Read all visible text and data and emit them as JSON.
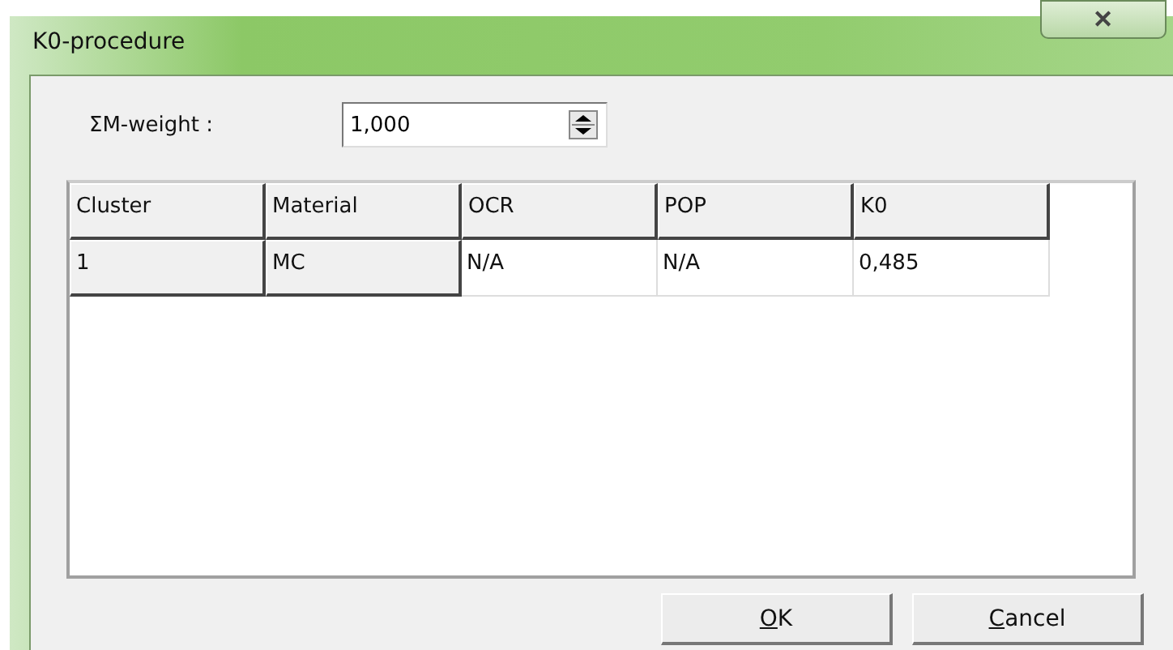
{
  "window": {
    "title": "K0-procedure",
    "close": "✕"
  },
  "weight": {
    "label": "ΣM-weight :",
    "value": "1,000"
  },
  "table": {
    "columns": [
      "Cluster",
      "Material",
      "OCR",
      "POP",
      "K0"
    ],
    "rows": [
      {
        "cells": [
          "1",
          "MC",
          "N/A",
          "N/A",
          "0,485"
        ]
      }
    ]
  },
  "buttons": [
    {
      "accel": "O",
      "rest": "K"
    },
    {
      "accel": "C",
      "rest": "ancel"
    }
  ]
}
